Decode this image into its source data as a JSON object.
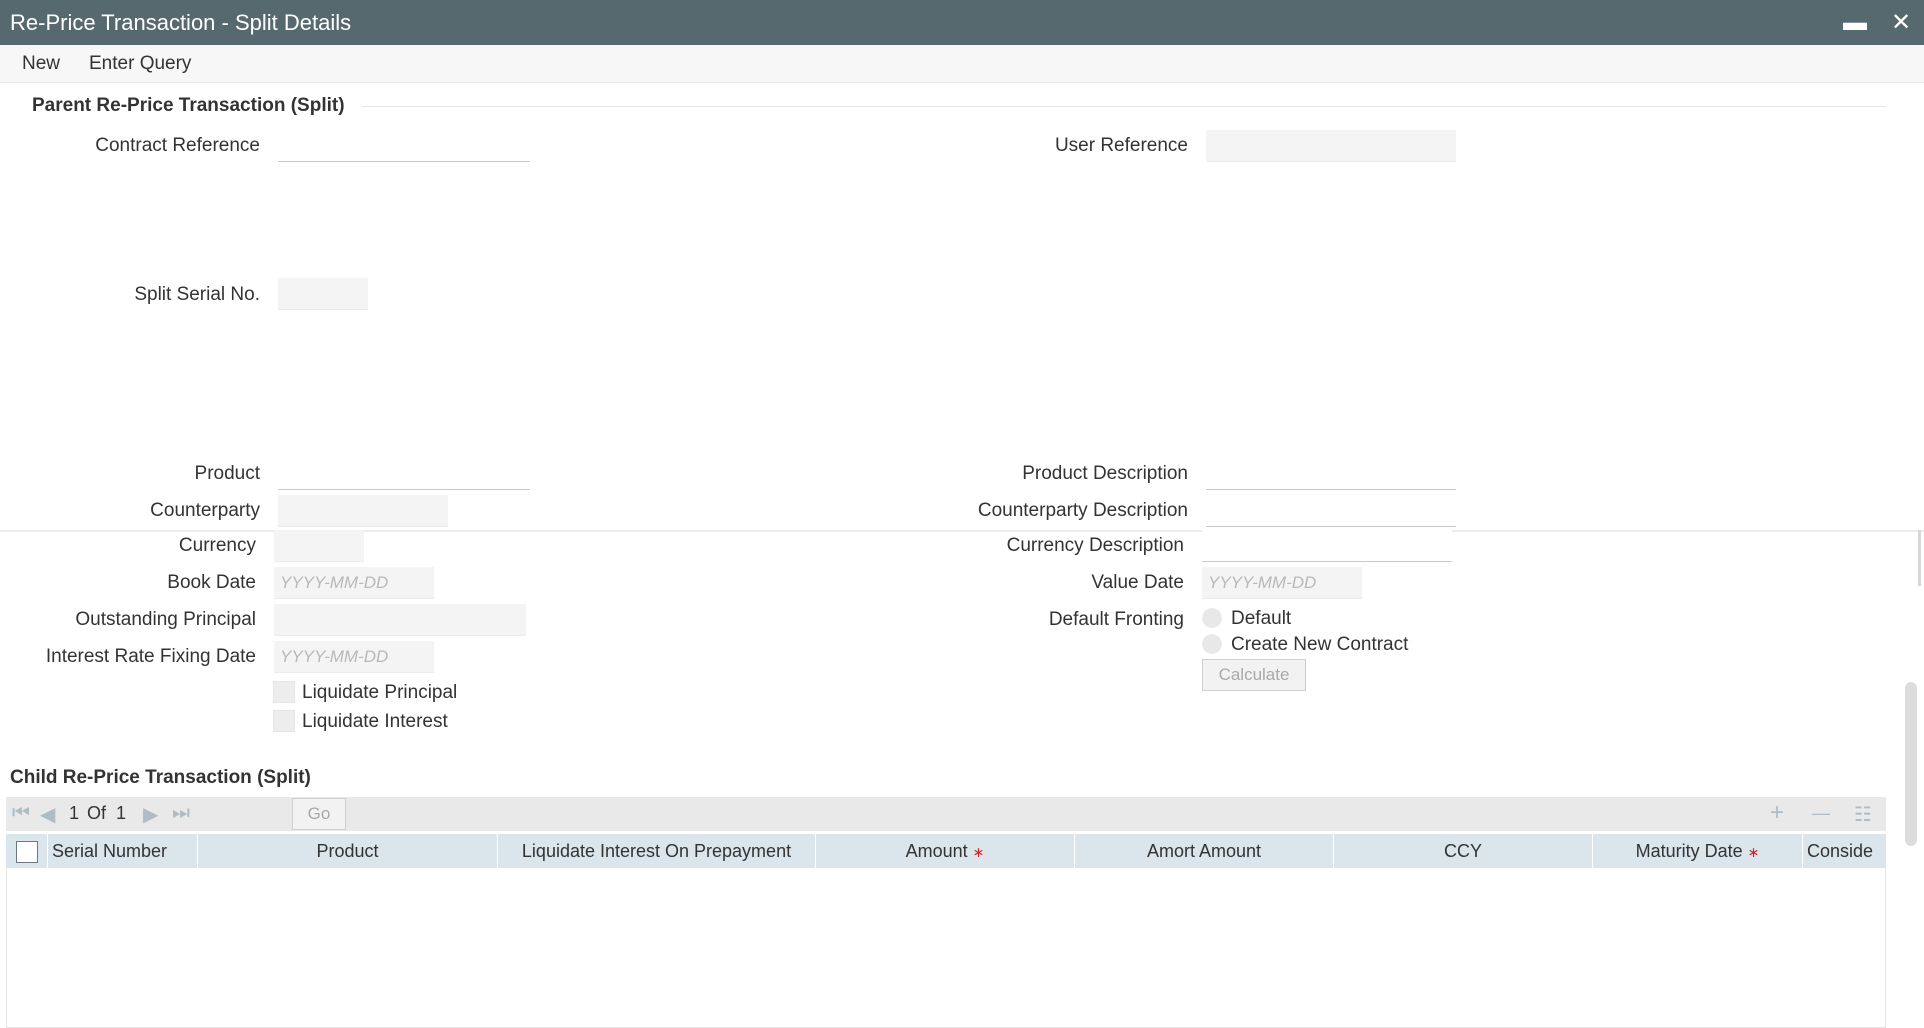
{
  "window": {
    "title": "Re-Price Transaction - Split Details",
    "minimize_glyph": "▬",
    "close_glyph": "✕"
  },
  "toolbar": {
    "new_label": "New",
    "enter_query_label": "Enter Query"
  },
  "parent": {
    "section_title": "Parent Re-Price Transaction (Split)",
    "contract_reference_label": "Contract Reference",
    "contract_reference_value": "",
    "user_reference_label": "User Reference",
    "user_reference_value": "",
    "split_serial_label": "Split Serial No.",
    "split_serial_value": "",
    "product_label": "Product",
    "product_value": "",
    "product_description_label": "Product Description",
    "product_description_value": "",
    "counterparty_label": "Counterparty",
    "counterparty_value": "",
    "counterparty_description_label": "Counterparty Description",
    "counterparty_description_value": "",
    "currency_label": "Currency",
    "currency_value": "",
    "currency_description_label": "Currency Description",
    "currency_description_value": "",
    "book_date_label": "Book Date",
    "book_date_placeholder": "YYYY-MM-DD",
    "value_date_label": "Value Date",
    "value_date_placeholder": "YYYY-MM-DD",
    "outstanding_principal_label": "Outstanding Principal",
    "outstanding_principal_value": "",
    "default_fronting_label": "Default Fronting",
    "default_fronting_options": [
      "Default",
      "Create New Contract"
    ],
    "interest_rate_fixing_date_label": "Interest Rate Fixing Date",
    "interest_rate_fixing_date_placeholder": "YYYY-MM-DD",
    "calculate_label": "Calculate",
    "liquidate_principal_label": "Liquidate Principal",
    "liquidate_interest_label": "Liquidate Interest"
  },
  "child": {
    "section_title": "Child Re-Price Transaction (Split)",
    "pagination": {
      "current": "1",
      "of_label": "Of",
      "total": "1",
      "go_label": "Go"
    },
    "grid_actions": {
      "add_glyph": "+",
      "remove_glyph": "—",
      "view_glyph": "☷"
    },
    "nav_glyphs": {
      "first": "⏮",
      "prev": "◀",
      "next": "▶",
      "last": "⏭"
    },
    "columns": [
      "Serial Number",
      "Product",
      "Liquidate Interest On Prepayment",
      "Amount",
      "Amort Amount",
      "CCY",
      "Maturity Date",
      "Conside"
    ],
    "required_marker": "∗",
    "rows": []
  },
  "colors": {
    "title_bar": "#56696f",
    "grid_header": "#dae5ec",
    "required": "#d62020"
  }
}
